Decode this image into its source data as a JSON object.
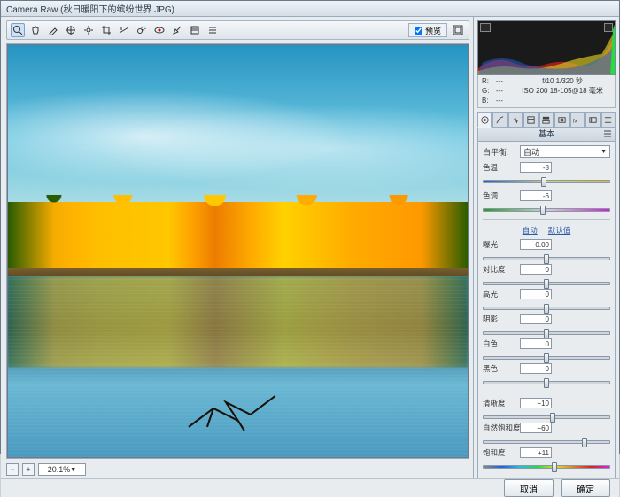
{
  "window": {
    "title": "Camera Raw (秋日暖阳下的缤纷世界.JPG)"
  },
  "toolbar": {
    "preview_label": "预览",
    "tools": [
      "zoom",
      "hand",
      "eyedrop",
      "sampler",
      "target",
      "crop",
      "straighten",
      "spot",
      "redeye",
      "adjust",
      "grad",
      "prefs"
    ]
  },
  "meta": {
    "r": "R:",
    "g": "G:",
    "b": "B:",
    "r_val": "---",
    "g_val": "---",
    "b_val": "---",
    "exif1": "f/10   1/320 秒",
    "exif2": "ISO 200   18-105@18 毫米"
  },
  "tabs": [
    "basic",
    "curve",
    "detail",
    "hsl",
    "split",
    "lens",
    "fx",
    "calib",
    "preset"
  ],
  "panel": {
    "title": "基本",
    "wb_label": "白平衡:",
    "wb_value": "自动",
    "auto_link": "自动",
    "default_link": "默认值",
    "sliders": {
      "temp": {
        "label": "色温",
        "value": "-8",
        "pos": 48
      },
      "tint": {
        "label": "色调",
        "value": "-6",
        "pos": 47
      },
      "exposure": {
        "label": "曝光",
        "value": "0.00",
        "pos": 50
      },
      "contrast": {
        "label": "对比度",
        "value": "0",
        "pos": 50
      },
      "highlights": {
        "label": "高光",
        "value": "0",
        "pos": 50
      },
      "shadows": {
        "label": "阴影",
        "value": "0",
        "pos": 50
      },
      "whites": {
        "label": "白色",
        "value": "0",
        "pos": 50
      },
      "blacks": {
        "label": "黑色",
        "value": "0",
        "pos": 50
      },
      "clarity": {
        "label": "清晰度",
        "value": "+10",
        "pos": 55
      },
      "vibrance": {
        "label": "自然饱和度",
        "value": "+60",
        "pos": 80
      },
      "saturation": {
        "label": "饱和度",
        "value": "+11",
        "pos": 56
      }
    }
  },
  "zoom": {
    "value": "20.1%"
  },
  "footer": {
    "cancel": "取消",
    "ok": "确定"
  }
}
